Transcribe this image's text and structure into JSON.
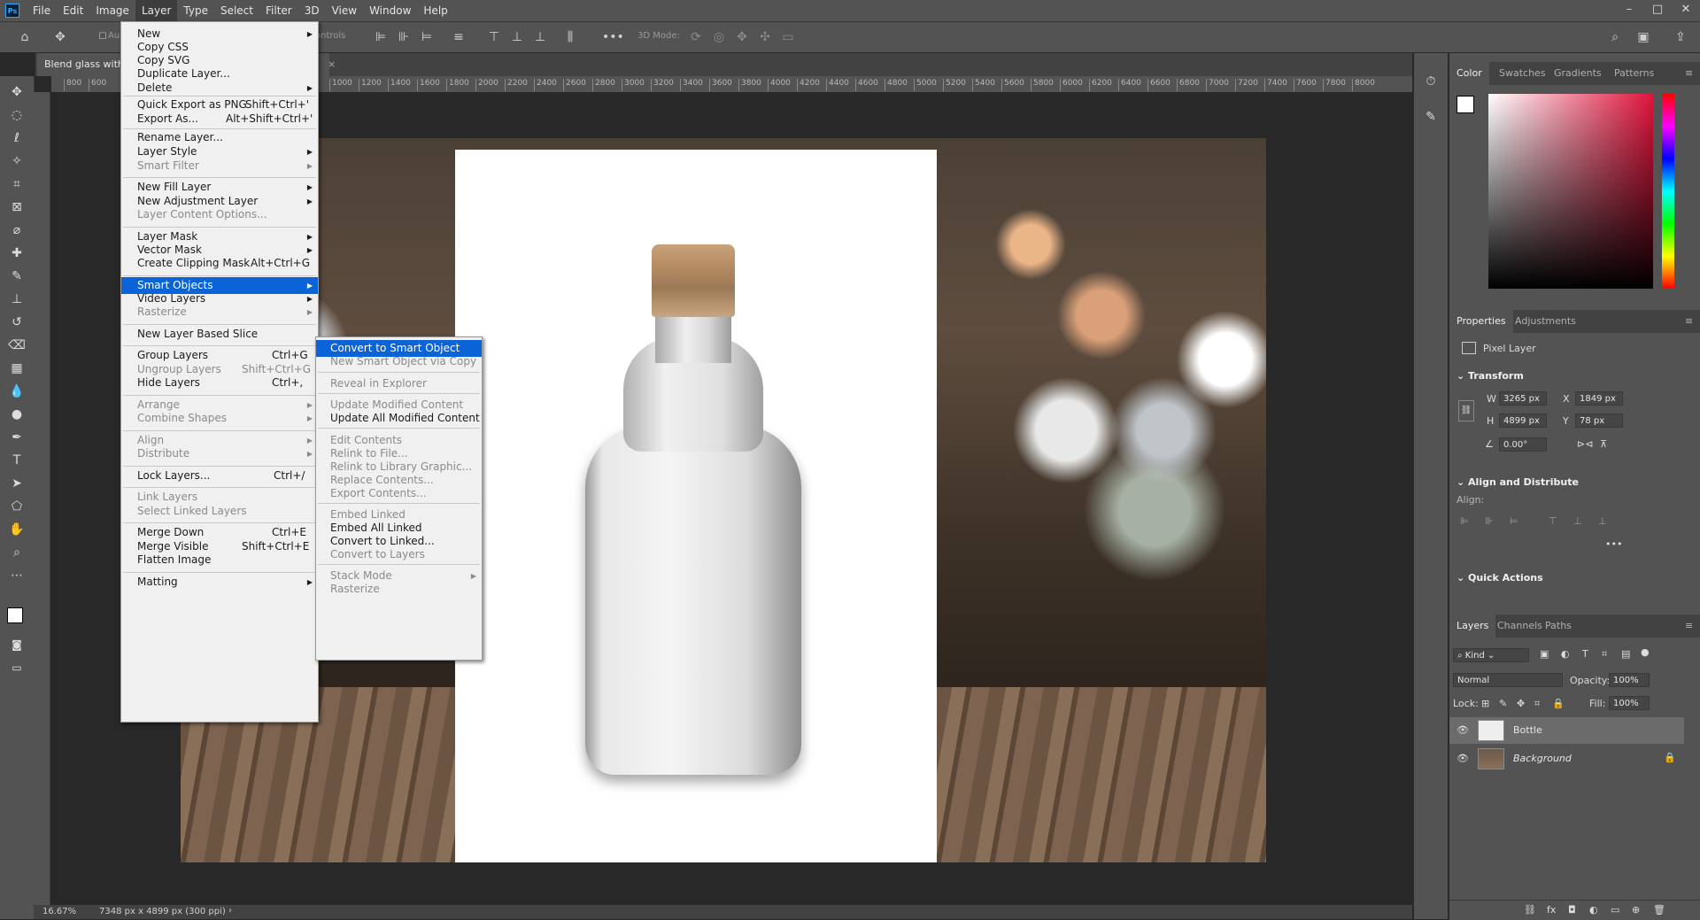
{
  "app": {
    "logo": "Ps",
    "menus": [
      "File",
      "Edit",
      "Image",
      "Layer",
      "Type",
      "Select",
      "Filter",
      "3D",
      "View",
      "Window",
      "Help"
    ],
    "active_menu": "Layer",
    "window_controls": [
      "–",
      "□",
      "✕"
    ]
  },
  "options_bar": {
    "home_icon": "home-icon",
    "auto_select_label": "Au",
    "controls_label": "ontrols",
    "mode_label": "3D Mode:",
    "more_icon": "•••"
  },
  "document": {
    "tab_title": "Blend glass with",
    "zoom": "16.67%",
    "doc_info": "7348 px x 4899 px (300 ppi)"
  },
  "ruler": {
    "ticks": [
      "800",
      "600",
      "1000",
      "1200",
      "1400",
      "1600",
      "1800",
      "2000",
      "2200",
      "2400",
      "2600",
      "2800",
      "3000",
      "3200",
      "3400",
      "3600",
      "3800",
      "4000",
      "4200",
      "4400",
      "4600",
      "4800",
      "5000",
      "5200",
      "5400",
      "5600",
      "5800",
      "6000",
      "6200",
      "6400",
      "6600",
      "6800",
      "7000",
      "7200",
      "7400",
      "7600",
      "7800",
      "8000"
    ]
  },
  "layer_menu": {
    "items": [
      {
        "label": "New",
        "shortcut": "",
        "submenu": true,
        "disabled": false
      },
      {
        "label": "Copy CSS",
        "shortcut": "",
        "submenu": false,
        "disabled": false
      },
      {
        "label": "Copy SVG",
        "shortcut": "",
        "submenu": false,
        "disabled": false
      },
      {
        "label": "Duplicate Layer...",
        "shortcut": "",
        "submenu": false,
        "disabled": false
      },
      {
        "label": "Delete",
        "shortcut": "",
        "submenu": true,
        "disabled": false
      },
      {
        "label": "Quick Export as PNG",
        "shortcut": "Shift+Ctrl+'",
        "submenu": false,
        "disabled": false
      },
      {
        "label": "Export As...",
        "shortcut": "Alt+Shift+Ctrl+'",
        "submenu": false,
        "disabled": false
      },
      {
        "label": "Rename Layer...",
        "shortcut": "",
        "submenu": false,
        "disabled": false
      },
      {
        "label": "Layer Style",
        "shortcut": "",
        "submenu": true,
        "disabled": false
      },
      {
        "label": "Smart Filter",
        "shortcut": "",
        "submenu": true,
        "disabled": true
      },
      {
        "label": "New Fill Layer",
        "shortcut": "",
        "submenu": true,
        "disabled": false
      },
      {
        "label": "New Adjustment Layer",
        "shortcut": "",
        "submenu": true,
        "disabled": false
      },
      {
        "label": "Layer Content Options...",
        "shortcut": "",
        "submenu": false,
        "disabled": true
      },
      {
        "label": "Layer Mask",
        "shortcut": "",
        "submenu": true,
        "disabled": false
      },
      {
        "label": "Vector Mask",
        "shortcut": "",
        "submenu": true,
        "disabled": false
      },
      {
        "label": "Create Clipping Mask",
        "shortcut": "Alt+Ctrl+G",
        "submenu": false,
        "disabled": false
      },
      {
        "label": "Smart Objects",
        "shortcut": "",
        "submenu": true,
        "disabled": false,
        "highlighted": true
      },
      {
        "label": "Video Layers",
        "shortcut": "",
        "submenu": true,
        "disabled": false
      },
      {
        "label": "Rasterize",
        "shortcut": "",
        "submenu": true,
        "disabled": true
      },
      {
        "label": "New Layer Based Slice",
        "shortcut": "",
        "submenu": false,
        "disabled": false
      },
      {
        "label": "Group Layers",
        "shortcut": "Ctrl+G",
        "submenu": false,
        "disabled": false
      },
      {
        "label": "Ungroup Layers",
        "shortcut": "Shift+Ctrl+G",
        "submenu": false,
        "disabled": true
      },
      {
        "label": "Hide Layers",
        "shortcut": "Ctrl+,",
        "submenu": false,
        "disabled": false
      },
      {
        "label": "Arrange",
        "shortcut": "",
        "submenu": true,
        "disabled": true
      },
      {
        "label": "Combine Shapes",
        "shortcut": "",
        "submenu": true,
        "disabled": true
      },
      {
        "label": "Align",
        "shortcut": "",
        "submenu": true,
        "disabled": true
      },
      {
        "label": "Distribute",
        "shortcut": "",
        "submenu": true,
        "disabled": true
      },
      {
        "label": "Lock Layers...",
        "shortcut": "Ctrl+/",
        "submenu": false,
        "disabled": false
      },
      {
        "label": "Link Layers",
        "shortcut": "",
        "submenu": false,
        "disabled": true
      },
      {
        "label": "Select Linked Layers",
        "shortcut": "",
        "submenu": false,
        "disabled": true
      },
      {
        "label": "Merge Down",
        "shortcut": "Ctrl+E",
        "submenu": false,
        "disabled": false
      },
      {
        "label": "Merge Visible",
        "shortcut": "Shift+Ctrl+E",
        "submenu": false,
        "disabled": false
      },
      {
        "label": "Flatten Image",
        "shortcut": "",
        "submenu": false,
        "disabled": false
      },
      {
        "label": "Matting",
        "shortcut": "",
        "submenu": true,
        "disabled": false
      }
    ]
  },
  "smart_objects_menu": {
    "items": [
      {
        "label": "Convert to Smart Object",
        "disabled": false,
        "highlighted": true,
        "submenu": false
      },
      {
        "label": "New Smart Object via Copy",
        "disabled": true,
        "submenu": false
      },
      {
        "label": "Reveal in Explorer",
        "disabled": true,
        "submenu": false
      },
      {
        "label": "Update Modified Content",
        "disabled": true,
        "submenu": false
      },
      {
        "label": "Update All Modified Content",
        "disabled": false,
        "submenu": false
      },
      {
        "label": "Edit Contents",
        "disabled": true,
        "submenu": false
      },
      {
        "label": "Relink to File...",
        "disabled": true,
        "submenu": false
      },
      {
        "label": "Relink to Library Graphic...",
        "disabled": true,
        "submenu": false
      },
      {
        "label": "Replace Contents...",
        "disabled": true,
        "submenu": false
      },
      {
        "label": "Export Contents...",
        "disabled": true,
        "submenu": false
      },
      {
        "label": "Embed Linked",
        "disabled": true,
        "submenu": false
      },
      {
        "label": "Embed All Linked",
        "disabled": false,
        "submenu": false
      },
      {
        "label": "Convert to Linked...",
        "disabled": false,
        "submenu": false
      },
      {
        "label": "Convert to Layers",
        "disabled": true,
        "submenu": false
      },
      {
        "label": "Stack Mode",
        "disabled": true,
        "submenu": true
      },
      {
        "label": "Rasterize",
        "disabled": true,
        "submenu": false
      }
    ]
  },
  "color_panel": {
    "tabs": [
      "Color",
      "Swatches",
      "Gradients",
      "Patterns"
    ],
    "active_tab": "Color",
    "hue_color": "#e0143c"
  },
  "properties_panel": {
    "tabs": [
      "Properties",
      "Adjustments"
    ],
    "layer_type": "Pixel Layer",
    "transform_title": "Transform",
    "w_label": "W",
    "w_value": "3265 px",
    "h_label": "H",
    "h_value": "4899 px",
    "x_label": "X",
    "x_value": "1849 px",
    "y_label": "Y",
    "y_value": "78 px",
    "angle_value": "0.00°",
    "align_title": "Align and Distribute",
    "align_label": "Align:",
    "quick_actions_title": "Quick Actions"
  },
  "layers_panel": {
    "tabs": [
      "Layers",
      "Channels",
      "Paths"
    ],
    "filter_kind": "Kind",
    "blend_mode": "Normal",
    "opacity_label": "Opacity:",
    "opacity_value": "100%",
    "lock_label": "Lock:",
    "fill_label": "Fill:",
    "fill_value": "100%",
    "layers": [
      {
        "name": "Bottle",
        "selected": true,
        "locked": false
      },
      {
        "name": "Background",
        "selected": false,
        "locked": true
      }
    ]
  }
}
